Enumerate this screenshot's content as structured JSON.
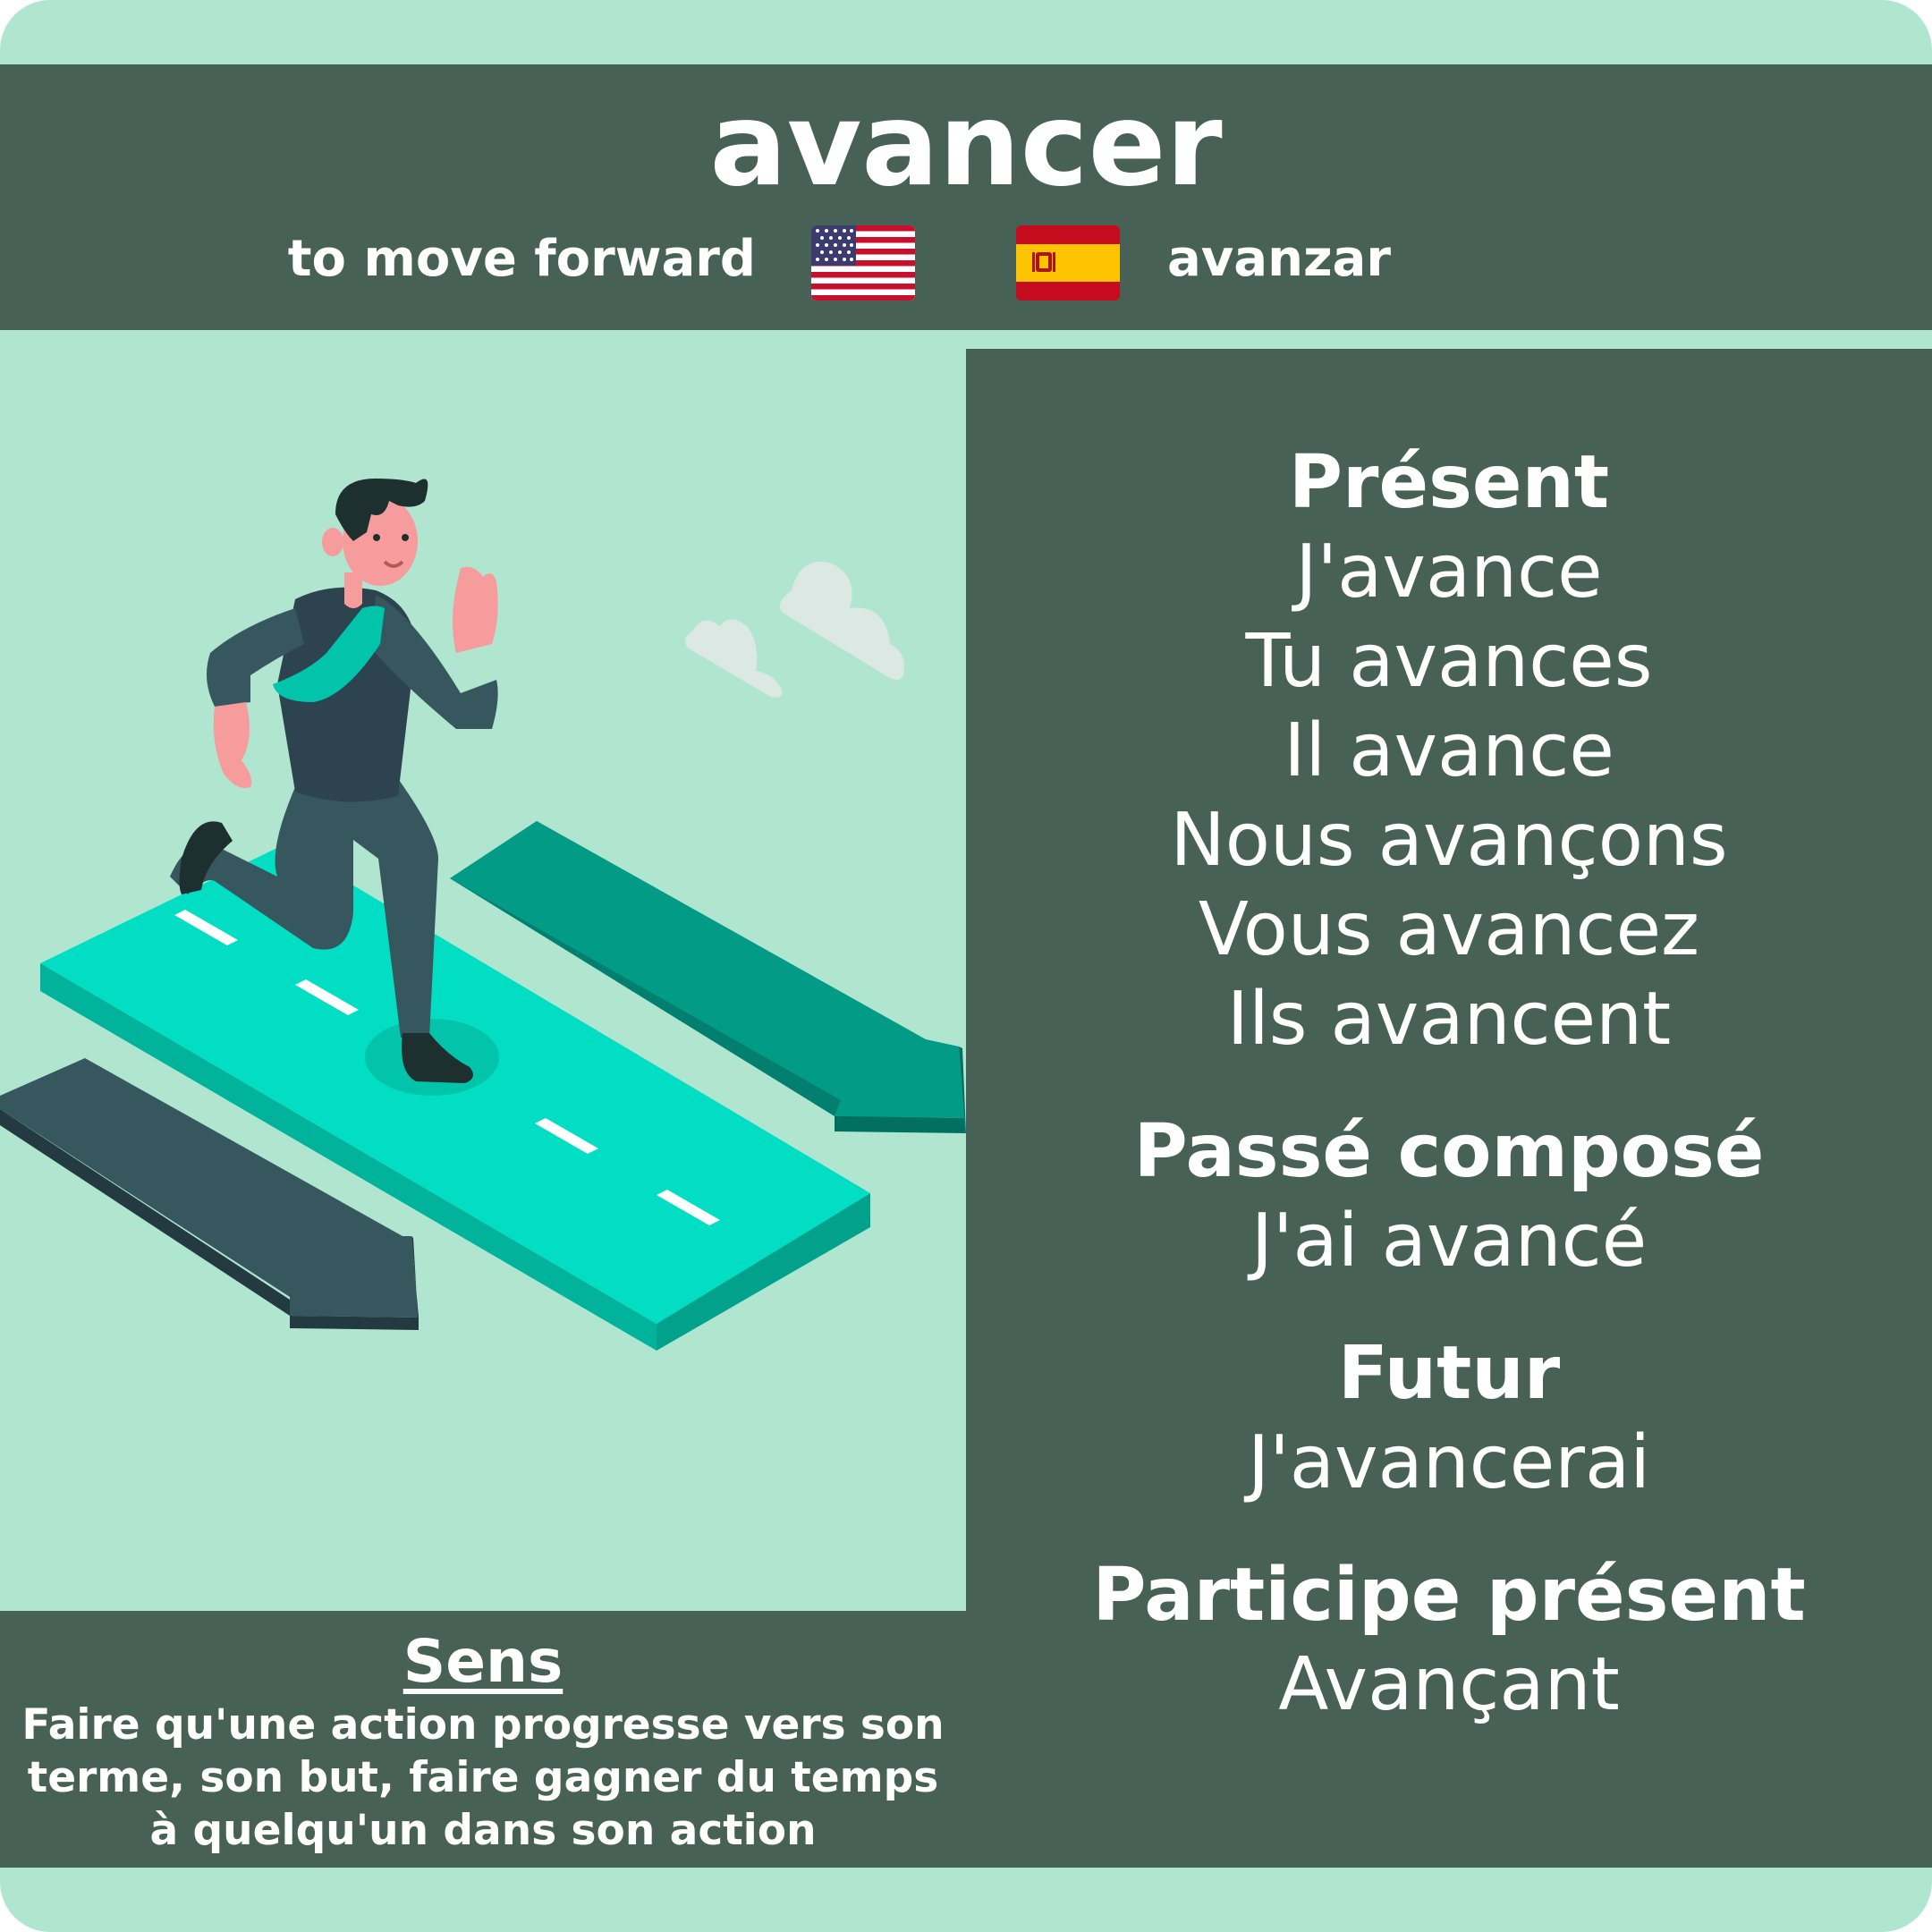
{
  "verb": "avancer",
  "translations": {
    "english": "to move forward",
    "spanish": "avanzar"
  },
  "flags": {
    "english_flag": "us-flag-icon",
    "spanish_flag": "spain-flag-icon"
  },
  "conjugation": {
    "present": {
      "label": "Présent",
      "forms": [
        "J'avance",
        "Tu avances",
        "Il avance",
        "Nous avançons",
        "Vous avancez",
        "Ils avancent"
      ]
    },
    "passe_compose": {
      "label": "Passé composé",
      "form": "J'ai avancé"
    },
    "futur": {
      "label": "Futur",
      "form": "J'avancerai"
    },
    "participe_present": {
      "label": "Participe présent",
      "form": "Avançant"
    }
  },
  "sens": {
    "title": "Sens",
    "definition": "Faire qu'une action progresse vers son terme, son but, faire gagner du temps à quelqu'un dans son action"
  },
  "colors": {
    "background": "#b0e6d0",
    "panel": "#486157",
    "road": "#02dec3",
    "arrow_teal": "#029b86",
    "arrow_dark": "#37575f"
  }
}
